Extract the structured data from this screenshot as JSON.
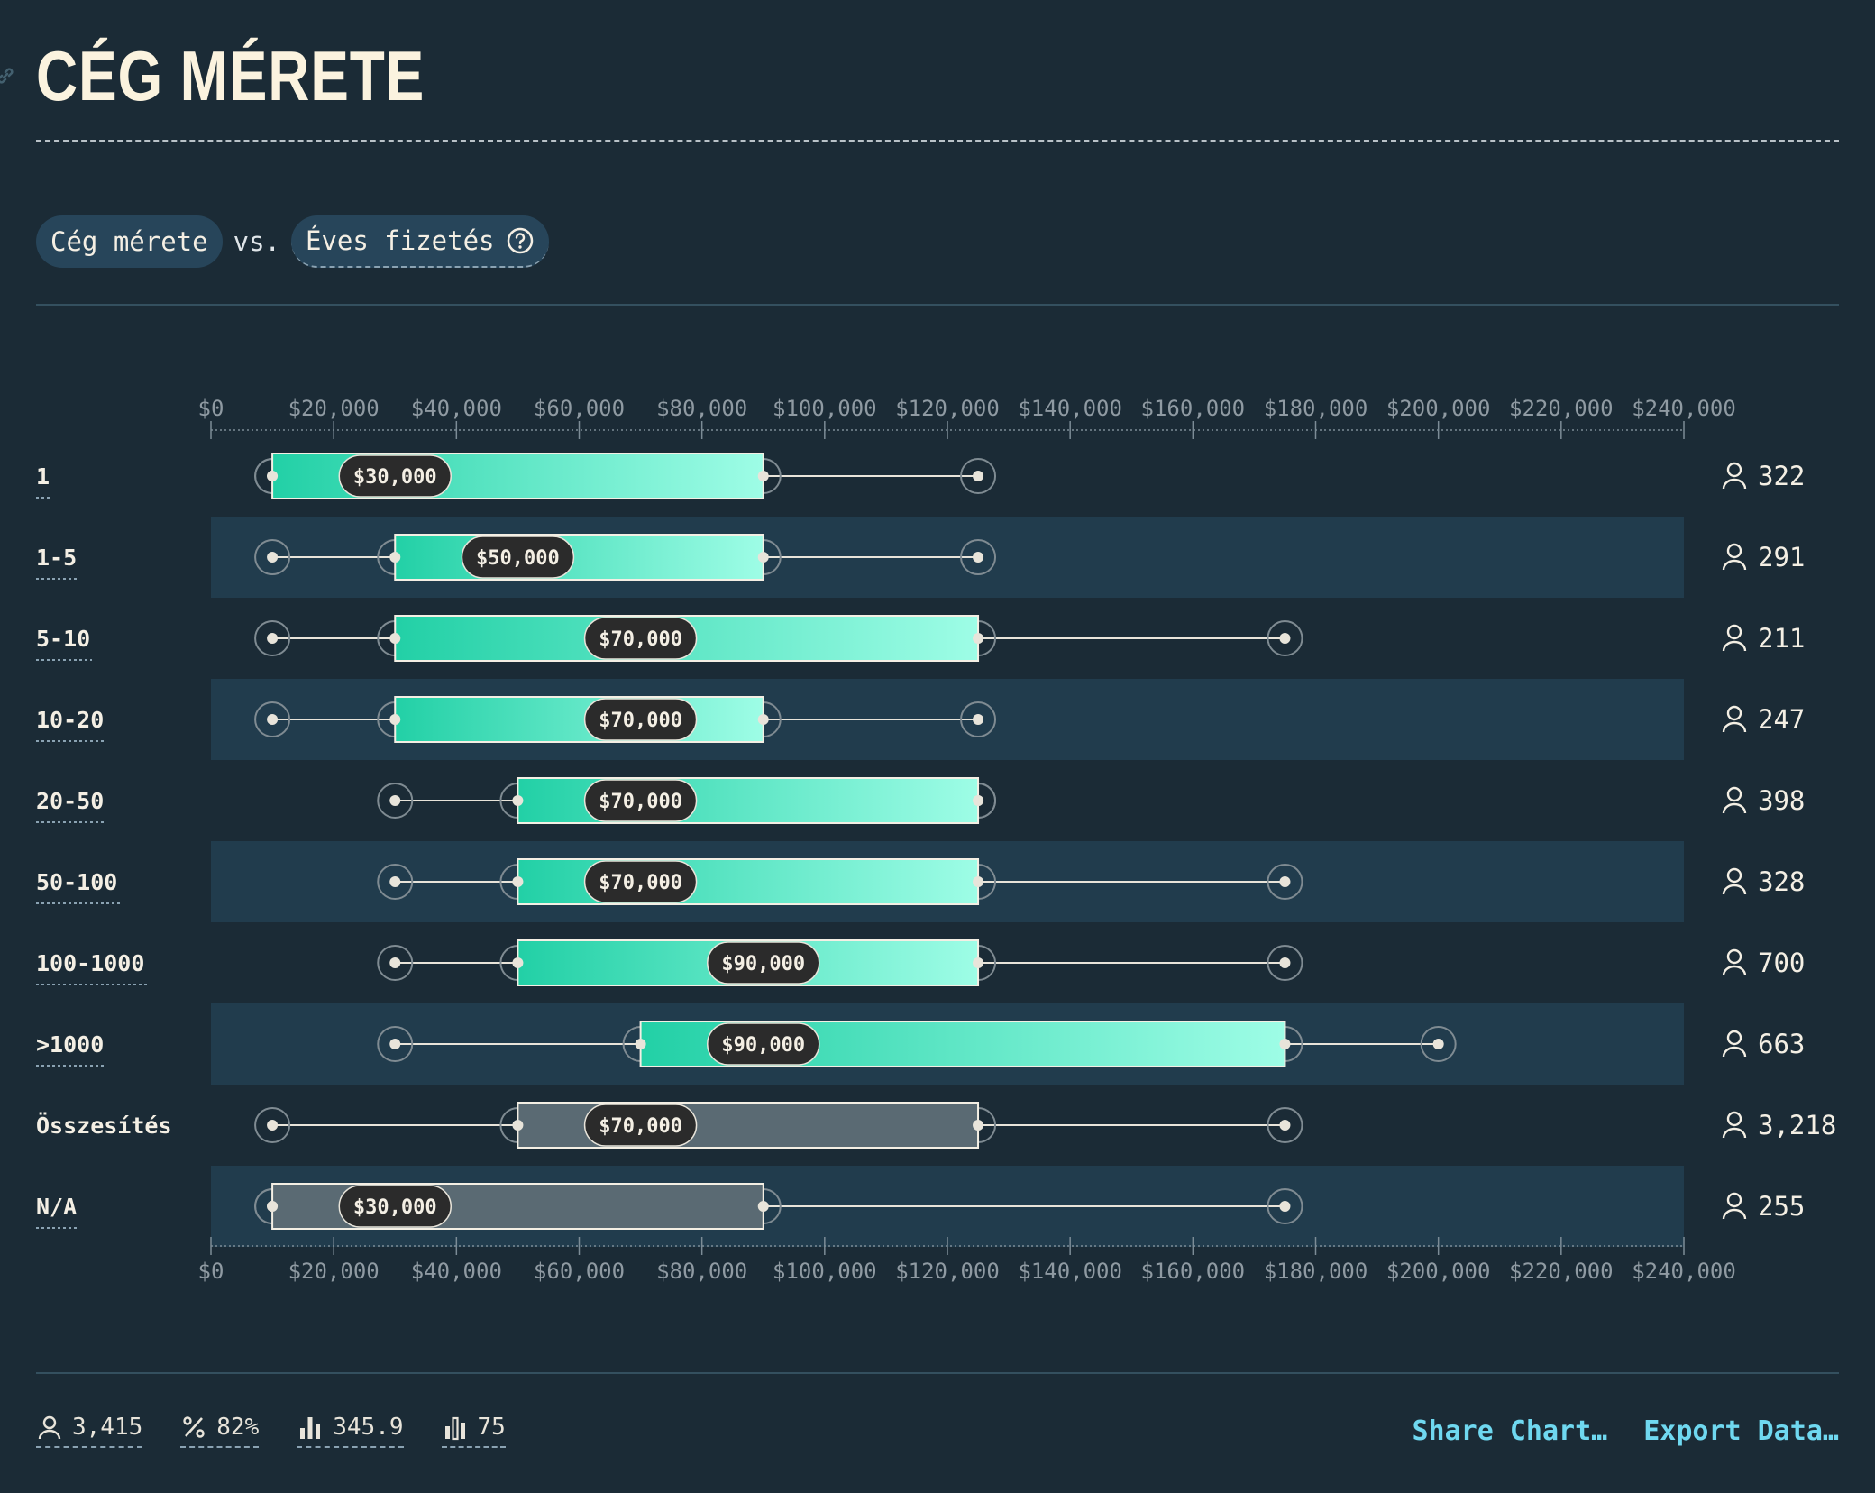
{
  "title": "CÉG MÉRETE",
  "selector": {
    "x_variable": "Cég mérete",
    "vs": "vs.",
    "y_variable": "Éves fizetés"
  },
  "colors": {
    "background": "#1b2b36",
    "stripe": "#213c4d",
    "box_gradient_start": "#22d0a6",
    "box_gradient_end": "#9efde6",
    "box_neutral": "#5a6a73",
    "median_badge": "#2b2b2b",
    "link": "#6fd8f0"
  },
  "chart_data": {
    "type": "box",
    "x_axis": {
      "min": 0,
      "max": 240000,
      "ticks": [
        "$0",
        "$20,000",
        "$40,000",
        "$60,000",
        "$80,000",
        "$100,000",
        "$120,000",
        "$140,000",
        "$160,000",
        "$180,000",
        "$200,000",
        "$220,000",
        "$240,000"
      ],
      "tick_values": [
        0,
        20000,
        40000,
        60000,
        80000,
        100000,
        120000,
        140000,
        160000,
        180000,
        200000,
        220000,
        240000
      ]
    },
    "rows": [
      {
        "label": "1",
        "min": 10000,
        "q1": 10000,
        "median": 30000,
        "q3": 90000,
        "max": 125000,
        "median_label": "$30,000",
        "count": "322",
        "style": "accent"
      },
      {
        "label": "1-5",
        "min": 10000,
        "q1": 30000,
        "median": 50000,
        "q3": 90000,
        "max": 125000,
        "median_label": "$50,000",
        "count": "291",
        "style": "accent"
      },
      {
        "label": "5-10",
        "min": 10000,
        "q1": 30000,
        "median": 70000,
        "q3": 125000,
        "max": 175000,
        "median_label": "$70,000",
        "count": "211",
        "style": "accent"
      },
      {
        "label": "10-20",
        "min": 10000,
        "q1": 30000,
        "median": 70000,
        "q3": 90000,
        "max": 125000,
        "median_label": "$70,000",
        "count": "247",
        "style": "accent"
      },
      {
        "label": "20-50",
        "min": 30000,
        "q1": 50000,
        "median": 70000,
        "q3": 125000,
        "max": 125000,
        "median_label": "$70,000",
        "count": "398",
        "style": "accent"
      },
      {
        "label": "50-100",
        "min": 30000,
        "q1": 50000,
        "median": 70000,
        "q3": 125000,
        "max": 175000,
        "median_label": "$70,000",
        "count": "328",
        "style": "accent"
      },
      {
        "label": "100-1000",
        "min": 30000,
        "q1": 50000,
        "median": 90000,
        "q3": 125000,
        "max": 175000,
        "median_label": "$90,000",
        "count": "700",
        "style": "accent"
      },
      {
        "label": ">1000",
        "min": 30000,
        "q1": 70000,
        "median": 90000,
        "q3": 175000,
        "max": 200000,
        "median_label": "$90,000",
        "count": "663",
        "style": "accent"
      },
      {
        "label": "Összesítés",
        "min": 10000,
        "q1": 50000,
        "median": 70000,
        "q3": 125000,
        "max": 175000,
        "median_label": "$70,000",
        "count": "3,218",
        "style": "neutral"
      },
      {
        "label": "N/A",
        "min": 10000,
        "q1": 10000,
        "median": 30000,
        "q3": 90000,
        "max": 175000,
        "median_label": "$30,000",
        "count": "255",
        "style": "neutral"
      }
    ]
  },
  "footer": {
    "respondents": "3,415",
    "percent": "82%",
    "stat_a": "345.9",
    "stat_b": "75",
    "share_label": "Share Chart…",
    "export_label": "Export Data…"
  }
}
